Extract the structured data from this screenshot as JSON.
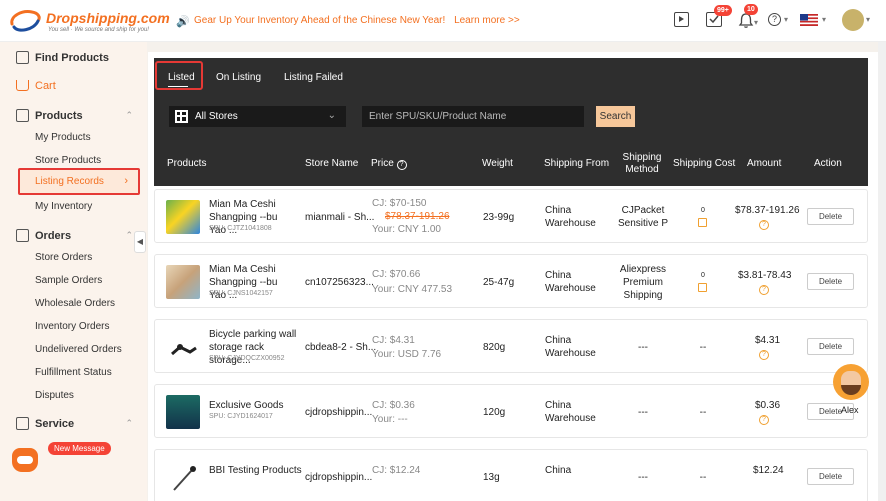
{
  "header": {
    "logo_name": "Dropshipping.com",
    "logo_tagline": "You sell · We source and ship for you!",
    "announcement": "Gear Up Your Inventory Ahead of the Chinese New Year!",
    "learn_more": "Learn more >>",
    "messages_badge": "99+",
    "notifications_badge": "10",
    "accent_color": "#f37021"
  },
  "sidebar": {
    "find_products": "Find Products",
    "cart": "Cart",
    "products": "Products",
    "products_items": [
      "My Products",
      "Store Products",
      "Listing Records",
      "My Inventory"
    ],
    "orders": "Orders",
    "orders_items": [
      "Store Orders",
      "Sample Orders",
      "Wholesale Orders",
      "Inventory Orders",
      "Undelivered Orders",
      "Fulfillment Status",
      "Disputes"
    ],
    "service": "Service",
    "new_message": "New Message"
  },
  "tabs": [
    "Listed",
    "On Listing",
    "Listing Failed"
  ],
  "filters": {
    "store_value": "All Stores",
    "search_placeholder": "Enter SPU/SKU/Product Name",
    "search_button": "Search"
  },
  "columns": [
    "Products",
    "Store Name",
    "Price",
    "Weight",
    "Shipping From",
    "Shipping Method",
    "Shipping Cost",
    "Amount",
    "Action"
  ],
  "rows": [
    {
      "name": "Mian Ma Ceshi Shangping --bu Yao ...",
      "sku": "SPU: CJTZ1041808",
      "store": "mianmali - Sh...",
      "price_cj": "CJ: $70-150",
      "price_old": "$78.37-191.26",
      "price_your": "Your: CNY 1.00",
      "weight": "23-99g",
      "ship_from": "China Warehouse",
      "method": "CJPacket Sensitive P",
      "cost": "0",
      "amount": "$78.37-191.26",
      "action": "Delete"
    },
    {
      "name": "Mian Ma Ceshi Shangping --bu Yao ...",
      "sku": "SPU: CJNS1042157",
      "store": "cn107256323...",
      "price_cj": "CJ: $70.66",
      "price_your": "Your: CNY 477.53",
      "weight": "25-47g",
      "ship_from": "China Warehouse",
      "method": "Aliexpress Premium Shipping",
      "cost": "0",
      "amount": "$3.81-78.43",
      "action": "Delete"
    },
    {
      "name": "Bicycle parking wall storage rack storage...",
      "sku": "SPU: CJYDQCZX00952",
      "store": "cbdea8-2 - Sh...",
      "price_cj": "CJ: $4.31",
      "price_your": "Your: USD 7.76",
      "weight": "820g",
      "ship_from": "China Warehouse",
      "method": "---",
      "cost": "--",
      "amount": "$4.31",
      "action": "Delete"
    },
    {
      "name": "Exclusive Goods",
      "sku": "SPU: CJYD1624017",
      "store": "cjdropshippin...",
      "price_cj": "CJ: $0.36",
      "price_your": "Your: ---",
      "weight": "120g",
      "ship_from": "China Warehouse",
      "method": "---",
      "cost": "--",
      "amount": "$0.36",
      "action": "Delete"
    },
    {
      "name": "BBI Testing Products",
      "store": "cjdropshippin...",
      "price_cj": "CJ: $12.24",
      "weight": "13g",
      "ship_from": "China",
      "method": "---",
      "cost": "--",
      "amount": "$12.24",
      "action": "Delete"
    }
  ],
  "chat_agent": "Alex"
}
